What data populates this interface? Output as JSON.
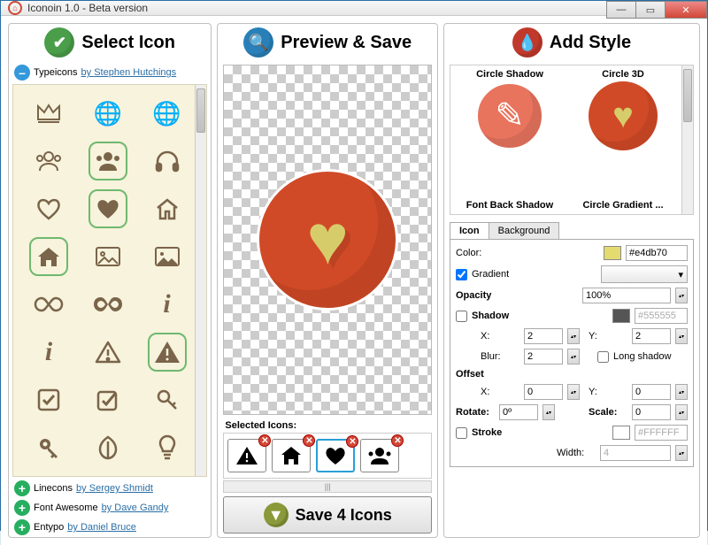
{
  "window": {
    "title": "Iconoin 1.0 - Beta version"
  },
  "headers": {
    "select": "Select Icon",
    "preview": "Preview & Save",
    "style": "Add Style"
  },
  "packs": {
    "open_name": "Typeicons",
    "open_author_prefix": "by ",
    "open_author": "Stephen Hutchings",
    "others": [
      {
        "name": "Linecons",
        "author": "Sergey Shmidt"
      },
      {
        "name": "Font Awesome",
        "author": "Dave Gandy"
      },
      {
        "name": "Entypo",
        "author": "Daniel Bruce"
      }
    ]
  },
  "selected_label": "Selected Icons:",
  "save_label": "Save 4 Icons",
  "styles": {
    "items": [
      "Circle Shadow",
      "Circle 3D",
      "Font Back Shadow",
      "Circle Gradient ..."
    ]
  },
  "tabs": {
    "icon": "Icon",
    "bg": "Background"
  },
  "form": {
    "color_label": "Color:",
    "color_value": "#e4db70",
    "gradient_label": "Gradient",
    "gradient_checked": true,
    "opacity_label": "Opacity",
    "opacity_value": "100%",
    "shadow_label": "Shadow",
    "shadow_checked": false,
    "shadow_color": "#555555",
    "x_label": "X:",
    "y_label": "Y:",
    "shadow_x": "2",
    "shadow_y": "2",
    "blur_label": "Blur:",
    "blur_value": "2",
    "long_shadow_label": "Long shadow",
    "long_shadow_checked": false,
    "offset_label": "Offset",
    "offset_x": "0",
    "offset_y": "0",
    "rotate_label": "Rotate:",
    "rotate_value": "0º",
    "scale_label": "Scale:",
    "scale_value": "0",
    "stroke_label": "Stroke",
    "stroke_checked": false,
    "stroke_color": "#FFFFFF",
    "width_label": "Width:",
    "width_value": "4"
  }
}
